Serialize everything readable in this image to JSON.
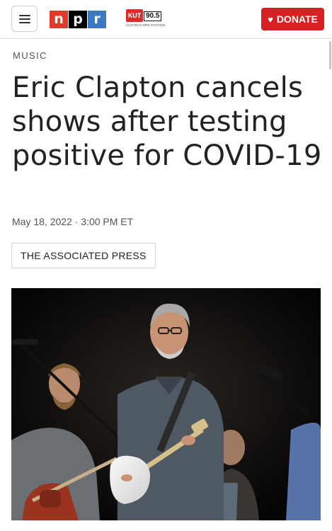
{
  "header": {
    "menu_icon": "hamburger-menu-icon",
    "logo": {
      "n": "n",
      "p": "p",
      "r": "r"
    },
    "station": {
      "mark": "KUT",
      "frequency": "90.5",
      "tagline": "AUSTIN'S NPR STATION"
    },
    "donate": {
      "icon": "heart-icon",
      "label": "DONATE"
    }
  },
  "article": {
    "section": "MUSIC",
    "headline": "Eric Clapton cancels shows after testing positive for COVID-19",
    "date": "May 18, 2022 · 3:00 PM ET",
    "byline": "THE ASSOCIATED PRESS"
  },
  "colors": {
    "accent": "#d62021",
    "npr_red": "#e03a2b",
    "npr_black": "#000000",
    "npr_blue": "#3a78c4"
  }
}
